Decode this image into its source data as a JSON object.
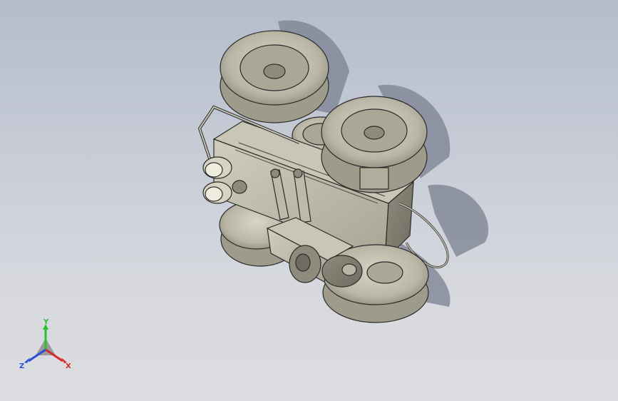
{
  "view": {
    "background": "#c9ced8",
    "model_color": "#bfbcac",
    "edge_color": "#2b2b2b",
    "shadow_color": "#7a8090"
  },
  "triad": {
    "x_label": "X",
    "y_label": "Y",
    "z_label": "Z",
    "x_color": "#d42a2a",
    "y_color": "#2bbf2b",
    "z_color": "#2b4fd4"
  }
}
